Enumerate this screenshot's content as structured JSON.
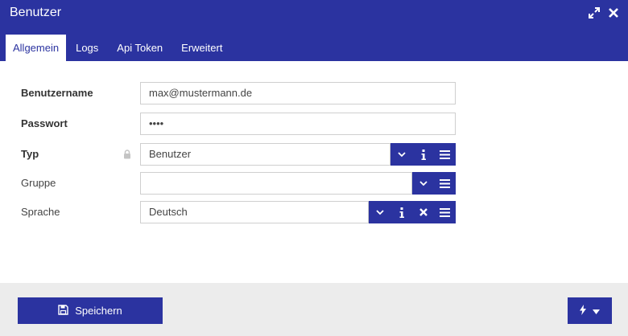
{
  "window": {
    "title": "Benutzer",
    "icons": [
      "expand-icon",
      "close-icon"
    ]
  },
  "tabs": [
    {
      "label": "Allgemein",
      "active": true
    },
    {
      "label": "Logs",
      "active": false
    },
    {
      "label": "Api Token",
      "active": false
    },
    {
      "label": "Erweitert",
      "active": false
    }
  ],
  "form": {
    "username": {
      "label": "Benutzername",
      "value": "max@mustermann.de"
    },
    "password": {
      "label": "Passwort",
      "value": "••••"
    },
    "type": {
      "label": "Typ",
      "value": "Benutzer",
      "locked": true,
      "buttons": [
        "chevron-down-icon",
        "info-icon",
        "list-icon"
      ]
    },
    "group": {
      "label": "Gruppe",
      "value": "",
      "buttons": [
        "chevron-down-icon",
        "list-icon"
      ]
    },
    "language": {
      "label": "Sprache",
      "value": "Deutsch",
      "buttons": [
        "chevron-down-icon",
        "info-icon",
        "clear-icon",
        "list-icon"
      ]
    }
  },
  "footer": {
    "save_label": "Speichern",
    "action_icons": [
      "lightning-icon",
      "caret-down-icon"
    ]
  },
  "colors": {
    "primary": "#2b33a0",
    "footer_bg": "#ececec",
    "border": "#cfcfcf"
  }
}
